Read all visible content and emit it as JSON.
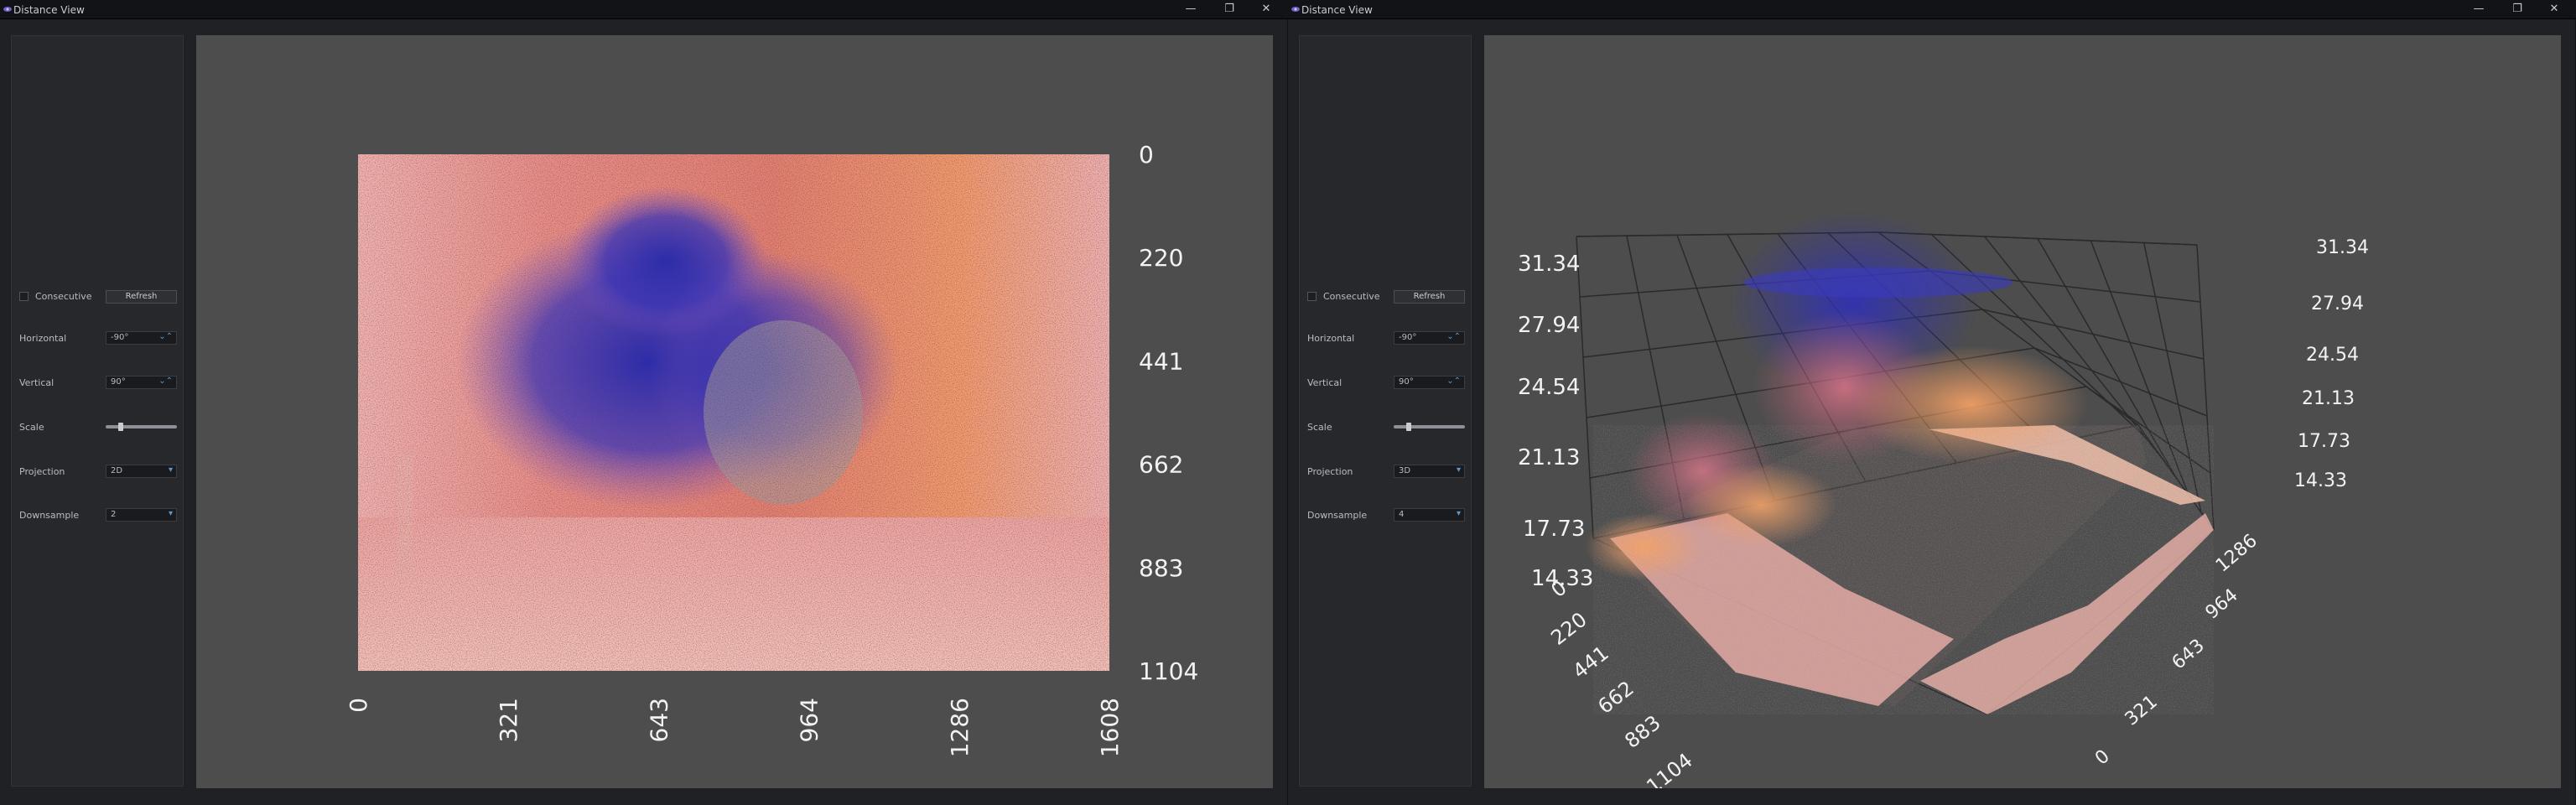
{
  "windows": [
    {
      "title": "Distance View",
      "title_buttons": {
        "minimize": "—",
        "restore": "❐",
        "close": "✕"
      },
      "controls": {
        "consecutive_label": "Consecutive",
        "refresh_label": "Refresh",
        "horizontal_label": "Horizontal",
        "horizontal_value": "-90°",
        "vertical_label": "Vertical",
        "vertical_value": "90°",
        "scale_label": "Scale",
        "projection_label": "Projection",
        "projection_value": "2D",
        "downsample_label": "Downsample",
        "downsample_value": "2"
      },
      "plot": {
        "y_ticks": [
          "0",
          "220",
          "441",
          "662",
          "883",
          "1104"
        ],
        "x_ticks": [
          "0",
          "321",
          "643",
          "964",
          "1286",
          "1608"
        ]
      }
    },
    {
      "title": "Distance View",
      "title_buttons": {
        "minimize": "—",
        "restore": "❐",
        "close": "✕"
      },
      "controls": {
        "consecutive_label": "Consecutive",
        "refresh_label": "Refresh",
        "horizontal_label": "Horizontal",
        "horizontal_value": "-90°",
        "vertical_label": "Vertical",
        "vertical_value": "90°",
        "scale_label": "Scale",
        "projection_label": "Projection",
        "projection_value": "3D",
        "downsample_label": "Downsample",
        "downsample_value": "4"
      },
      "plot3d": {
        "z_ticks": [
          "31.34",
          "27.94",
          "24.54",
          "21.13",
          "17.73",
          "14.33"
        ],
        "left_axis_ticks": [
          "0",
          "220",
          "441",
          "662",
          "883",
          "1104"
        ],
        "right_axis_ticks": [
          "1286",
          "964",
          "643",
          "321",
          "0"
        ]
      }
    }
  ],
  "colors": {
    "panel_bg": "#4d4d4d",
    "sidebar_bg": "#27282b",
    "accent": "#5b9bd5",
    "far": "#2b2bb0",
    "mid": "#f08a78",
    "near": "#f6b8b0"
  }
}
